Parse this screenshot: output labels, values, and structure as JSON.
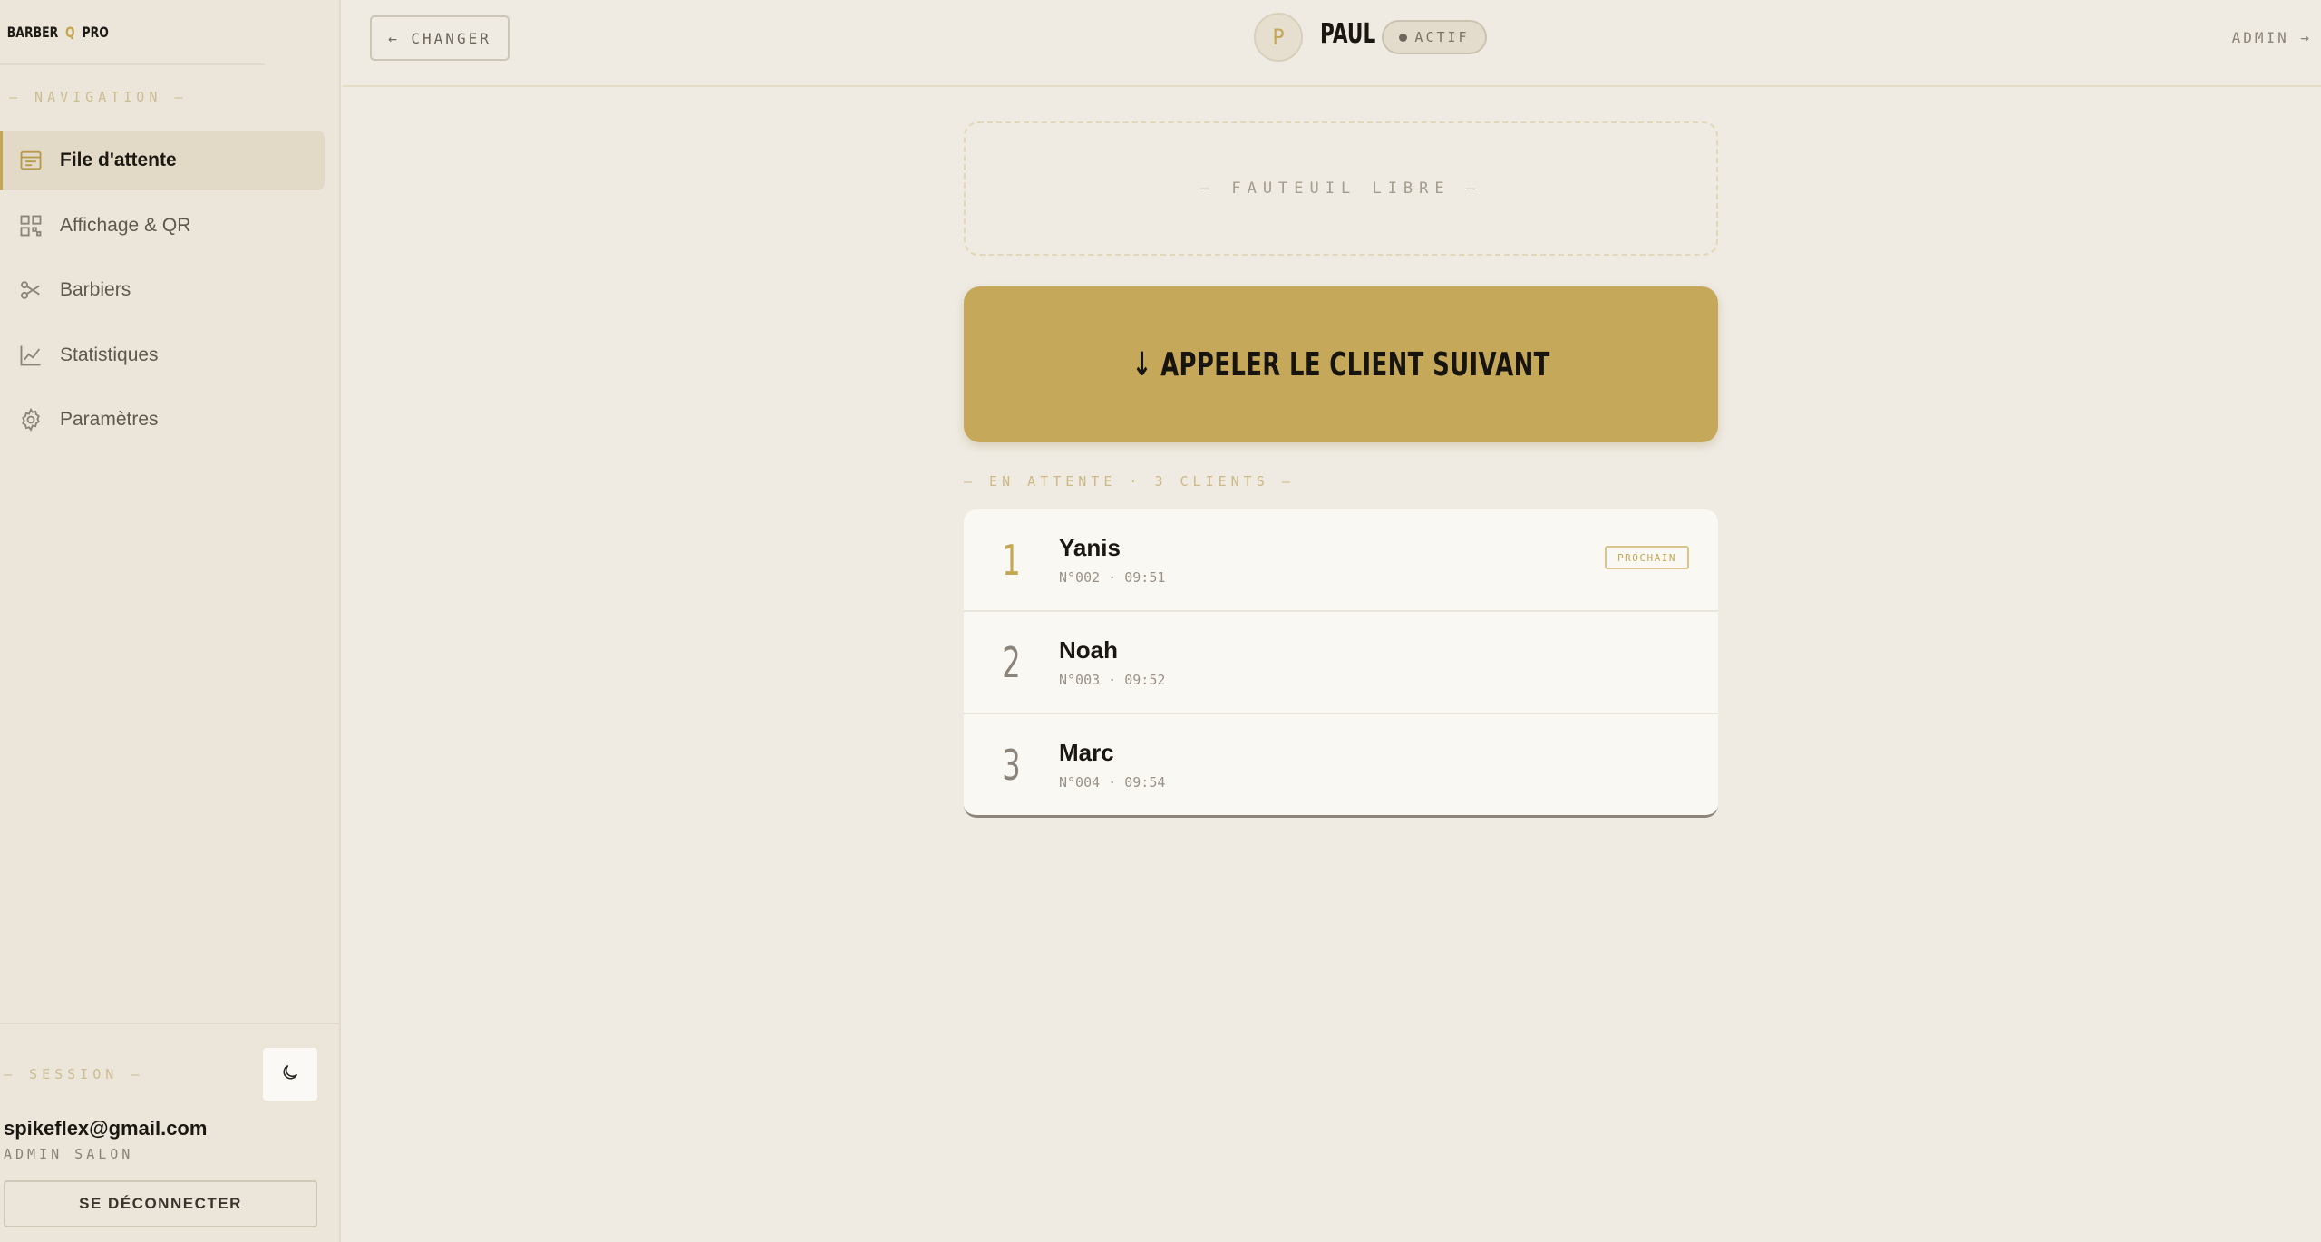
{
  "brand": {
    "left": "BARBER",
    "mark": "Q",
    "right": "PRO"
  },
  "sidebar": {
    "nav_heading": "— NAVIGATION —",
    "items": [
      {
        "label": "File d'attente",
        "icon": "queue-list-icon",
        "active": true
      },
      {
        "label": "Affichage & QR",
        "icon": "qr-grid-icon",
        "active": false
      },
      {
        "label": "Barbiers",
        "icon": "scissors-icon",
        "active": false
      },
      {
        "label": "Statistiques",
        "icon": "chart-line-icon",
        "active": false
      },
      {
        "label": "Paramètres",
        "icon": "gear-icon",
        "active": false
      }
    ],
    "session": {
      "heading": "— SESSION —",
      "email": "spikeflex@gmail.com",
      "role": "ADMIN SALON",
      "logout_label": "SE DÉCONNECTER",
      "theme_icon": "moon-icon"
    }
  },
  "topbar": {
    "change_label": "← CHANGER",
    "avatar_initial": "P",
    "barber_name": "PAUL",
    "status_label": "ACTIF",
    "admin_label": "ADMIN →"
  },
  "main": {
    "chair_status": "— FAUTEUIL LIBRE —",
    "call_button_label": "↓ APPELER LE CLIENT SUIVANT",
    "queue_heading": "— EN ATTENTE · 3 CLIENTS —",
    "queue": [
      {
        "position": "1",
        "name": "Yanis",
        "meta": "N°002 · 09:51",
        "badge": "PROCHAIN"
      },
      {
        "position": "2",
        "name": "Noah",
        "meta": "N°003 · 09:52",
        "badge": ""
      },
      {
        "position": "3",
        "name": "Marc",
        "meta": "N°004 · 09:54",
        "badge": ""
      }
    ]
  },
  "colors": {
    "accent": "#c5a859",
    "background": "#efebe3",
    "sidebar": "#ebe5da"
  }
}
